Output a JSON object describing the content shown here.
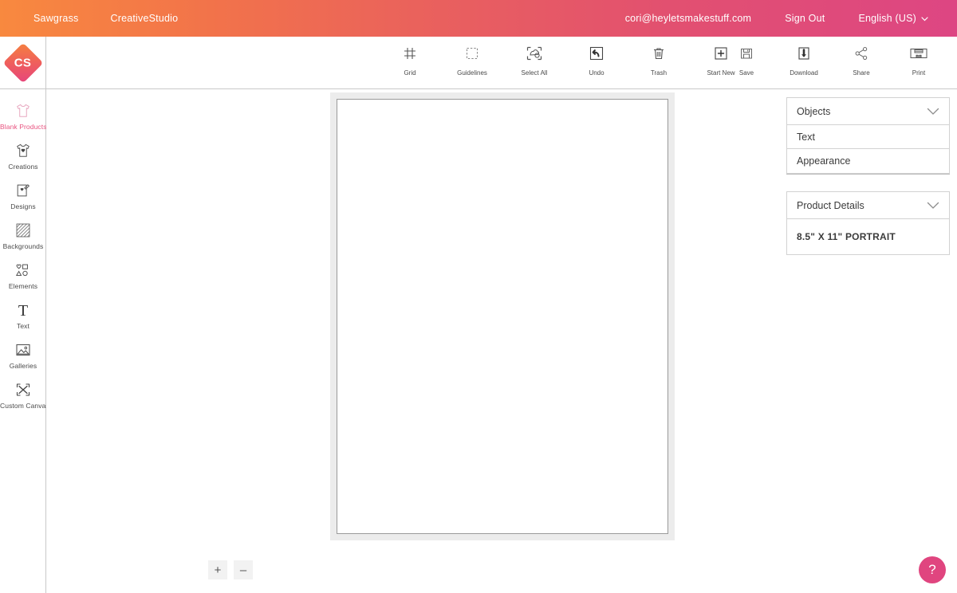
{
  "topbar": {
    "brand": "Sawgrass",
    "product": "CreativeStudio",
    "account_email": "cori@heyletsmakestuff.com",
    "sign_out": "Sign Out",
    "language": "English (US)",
    "caret_icon": "chevron-down-icon",
    "gradient_start": "#f8893f",
    "gradient_end": "#dd4683"
  },
  "logo": {
    "text": "CS",
    "shape": "diamond",
    "gradient_start": "#f5813f",
    "gradient_end": "#e6457d"
  },
  "sidebar": {
    "active_color": "#e8527f",
    "items": [
      {
        "label": "Blank Products",
        "icon": "tshirt-outline-icon",
        "active": true
      },
      {
        "label": "Creations",
        "icon": "tshirt-design-icon",
        "active": false
      },
      {
        "label": "Designs",
        "icon": "design-card-icon",
        "active": false
      },
      {
        "label": "Backgrounds",
        "icon": "hatch-pattern-icon",
        "active": false
      },
      {
        "label": "Elements",
        "icon": "shapes-icon",
        "active": false
      },
      {
        "label": "Text",
        "icon": "text-t-icon",
        "active": false
      },
      {
        "label": "Galleries",
        "icon": "image-gallery-icon",
        "active": false
      },
      {
        "label": "Custom Canvas",
        "icon": "expand-arrows-icon",
        "active": false
      }
    ]
  },
  "toolbar": {
    "center_tools": [
      {
        "label": "Grid",
        "icon": "grid-icon"
      },
      {
        "label": "Guidelines",
        "icon": "guidelines-dashed-square-icon"
      },
      {
        "label": "Select All",
        "icon": "select-all-icon"
      },
      {
        "label": "Undo",
        "icon": "undo-arrow-icon"
      },
      {
        "label": "Trash",
        "icon": "trash-can-icon"
      },
      {
        "label": "Start New",
        "icon": "plus-square-icon"
      }
    ],
    "right_tools": [
      {
        "label": "Save",
        "icon": "floppy-disk-icon"
      },
      {
        "label": "Download",
        "icon": "download-arrow-icon"
      },
      {
        "label": "Share",
        "icon": "share-nodes-icon"
      },
      {
        "label": "Print",
        "icon": "printer-icon"
      }
    ]
  },
  "zoom_controls": {
    "zoom_in": "+",
    "zoom_out": "–"
  },
  "panels": {
    "objects": {
      "header": "Objects",
      "chevron_icon": "chevron-down-icon",
      "rows": [
        "Text",
        "Appearance"
      ]
    },
    "product_details": {
      "header": "Product Details",
      "chevron_icon": "chevron-down-icon",
      "value": "8.5\" X 11\" PORTRAIT"
    }
  },
  "help": {
    "label": "?",
    "icon": "question-mark-icon",
    "color": "#e0457f"
  }
}
